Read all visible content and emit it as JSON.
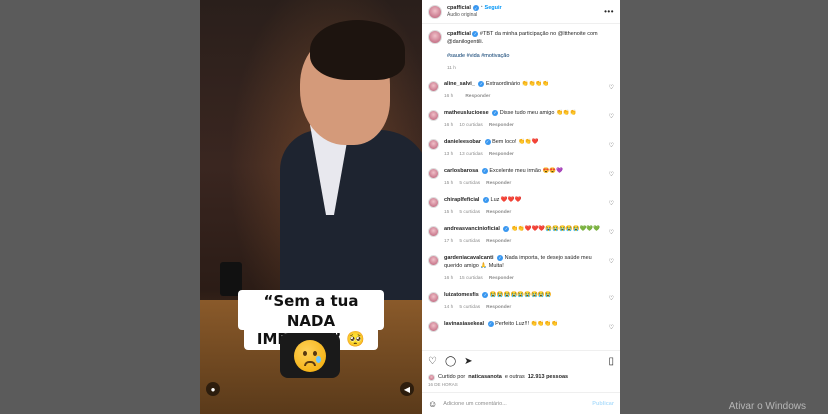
{
  "post": {
    "author": "cpafficial",
    "follow_label": "Seguir",
    "audio_label": "Áudio original",
    "caption_lines": [
      "#TBT da minha participação no @ltthenoite com @danilogentili.",
      "#saude #vida #motivação"
    ],
    "caption_time": "11 h"
  },
  "video": {
    "caption_line1": "“Sem a tua saúde,",
    "caption_line2": "NADA IMPORTA” 🥺"
  },
  "comments": [
    {
      "user": "aline_salvi_",
      "text": "Extraordinário 👏👏👏👏",
      "time": "16 h",
      "likes": "",
      "reply": "Responder"
    },
    {
      "user": "matheuslucioese",
      "text": "Disse tudo meu amigo 👏👏👏",
      "time": "16 h",
      "likes": "10 curtidas",
      "reply": "Responder"
    },
    {
      "user": "danieleesobar",
      "text": "Bem loco! 👏👏❤️",
      "time": "13 h",
      "likes": "13 curtidas",
      "reply": "Responder"
    },
    {
      "user": "carlosbarosa",
      "text": "Excelente meu irmão 😍😍💜",
      "time": "15 h",
      "likes": "5 curtidas",
      "reply": "Responder"
    },
    {
      "user": "chiraplfeficial",
      "text": "Luz ❤️❤️❤️",
      "time": "15 h",
      "likes": "5 curtidas",
      "reply": "Responder"
    },
    {
      "user": "andreasvancinioficial",
      "text": "👏👏❤️❤️❤️😭😭😭😭😭💚💚💚",
      "time": "17 h",
      "likes": "5 curtidas",
      "reply": "Responder"
    },
    {
      "user": "gardeniacavalcanti",
      "text": "Nada importa, te desejo saúde meu querido amigo 🙏 Muita!",
      "time": "16 h",
      "likes": "15 curtidas",
      "reply": "Responder"
    },
    {
      "user": "luizatomesfis",
      "text": "😭😭😭😭😭😭😭😭😭",
      "time": "14 h",
      "likes": "5 curtidas",
      "reply": "Responder"
    },
    {
      "user": "lavinasiasekeal",
      "text": "Perfeito Luz!!! 👏👏👏👏",
      "time": "",
      "likes": "",
      "reply": ""
    }
  ],
  "likes": {
    "text_prefix": "Curtido por",
    "first_user": "naticasanota",
    "text_suffix": "e outras",
    "count": "12.913 pessoas"
  },
  "post_date": "16 DE HORAS",
  "add_comment_placeholder": "Adicione um comentário...",
  "publish_label": "Publicar",
  "watermark": "Ativar o Windows",
  "icons": {
    "heart": "heart-icon",
    "comment": "comment-icon",
    "share": "share-icon",
    "save": "bookmark-icon",
    "emoji": "emoji-icon",
    "more": "more-icon",
    "verified": "verified-icon"
  }
}
